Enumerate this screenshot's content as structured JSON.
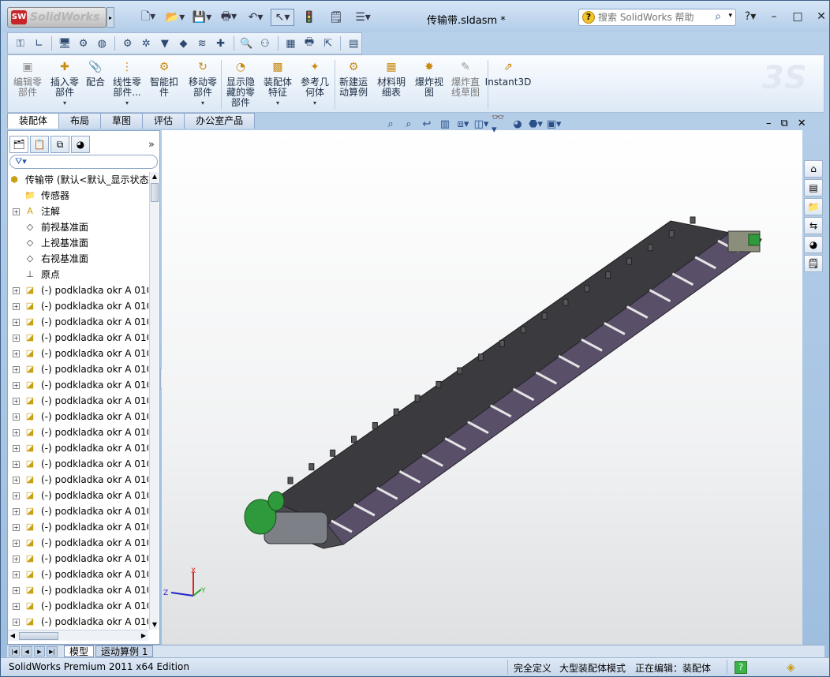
{
  "app": {
    "brand": "SolidWorks",
    "badge": "SW"
  },
  "document": {
    "title": "传输带.sldasm *"
  },
  "search": {
    "placeholder": "搜索 SolidWorks 帮助"
  },
  "ribbon": {
    "buttons": [
      {
        "id": "edit-part",
        "label": "编辑零\n部件",
        "disabled": true
      },
      {
        "id": "insert-part",
        "label": "插入零\n部件",
        "caret": true
      },
      {
        "id": "mate",
        "label": "配合"
      },
      {
        "id": "linear-pattern",
        "label": "线性零\n部件...",
        "caret": true
      },
      {
        "id": "smart-fastener",
        "label": "智能扣\n件"
      },
      {
        "id": "move-component",
        "label": "移动零\n部件",
        "caret": true
      },
      {
        "id": "show-hidden",
        "label": "显示隐\n藏的零\n部件"
      },
      {
        "id": "assembly-feature",
        "label": "装配体\n特征",
        "caret": true
      },
      {
        "id": "reference-geometry",
        "label": "参考几\n何体",
        "caret": true
      },
      {
        "id": "new-motion-study",
        "label": "新建运\n动算例"
      },
      {
        "id": "bom",
        "label": "材料明\n细表"
      },
      {
        "id": "exploded-view",
        "label": "爆炸视\n图"
      },
      {
        "id": "explode-line-sketch",
        "label": "爆炸直\n线草图",
        "disabled": true
      },
      {
        "id": "instant3d",
        "label": "Instant3D"
      }
    ]
  },
  "tabs": [
    "装配体",
    "布局",
    "草图",
    "评估",
    "办公室产品"
  ],
  "tree": {
    "root": "传输带 (默认<默认_显示状态",
    "items": [
      {
        "label": "传感器",
        "icon": "sensor-folder-icon",
        "expand": false
      },
      {
        "label": "注解",
        "icon": "annotation-icon",
        "expand": true
      },
      {
        "label": "前视基准面",
        "icon": "plane-icon",
        "expand": false
      },
      {
        "label": "上视基准面",
        "icon": "plane-icon",
        "expand": false
      },
      {
        "label": "右视基准面",
        "icon": "plane-icon",
        "expand": false
      },
      {
        "label": "原点",
        "icon": "origin-icon",
        "expand": false
      }
    ],
    "part_label": "(-) podkladka okr A 010",
    "part_count": 22
  },
  "bottom_tabs": [
    "模型",
    "运动算例 1"
  ],
  "status": {
    "product": "SolidWorks Premium 2011 x64 Edition",
    "fully_defined": "完全定义",
    "large_assembly": "大型装配体模式",
    "editing": "正在编辑：装配体"
  },
  "triad": {
    "x": "X",
    "y": "Y",
    "z": "Z"
  },
  "colors": {
    "accent": "#b9d1ea",
    "brand": "#c8242b",
    "model_dark": "#3c3c40",
    "model_frame": "#5a4f68"
  }
}
